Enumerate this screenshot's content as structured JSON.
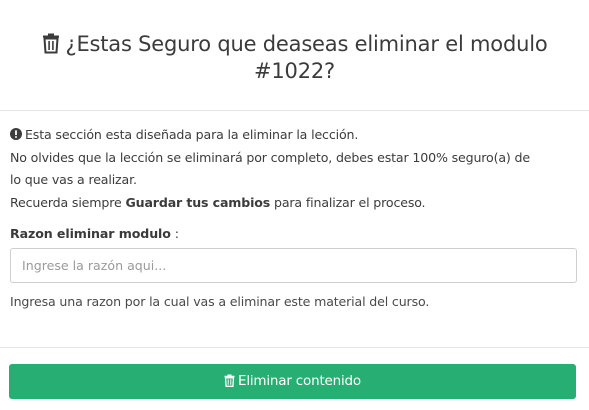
{
  "header": {
    "title_icon": "trash-icon",
    "title": "¿Estas Seguro que deaseas eliminar el modulo #1022?"
  },
  "info": {
    "icon": "exclamation-circle-icon",
    "line1": "Esta sección esta diseñada para la eliminar la lección.",
    "line2": "No olvides que la lección se eliminará por completo, debes estar 100% seguro(a) de",
    "line3": "lo que vas a realizar.",
    "line4_prefix": "Recuerda siempre ",
    "line4_strong": "Guardar tus cambios",
    "line4_suffix": " para finalizar el proceso."
  },
  "form": {
    "label": "Razon eliminar modulo",
    "label_colon": " :",
    "placeholder": "Ingrese la razón aqui...",
    "value": "",
    "help": "Ingresa una razon por la cual vas a eliminar este material del curso."
  },
  "footer": {
    "button_icon": "trash-icon",
    "button_label": "Eliminar contenido"
  },
  "colors": {
    "button_bg": "#27ae72",
    "button_text": "#ffffff",
    "divider": "#e5e5e5",
    "text": "#3a3a3a"
  }
}
